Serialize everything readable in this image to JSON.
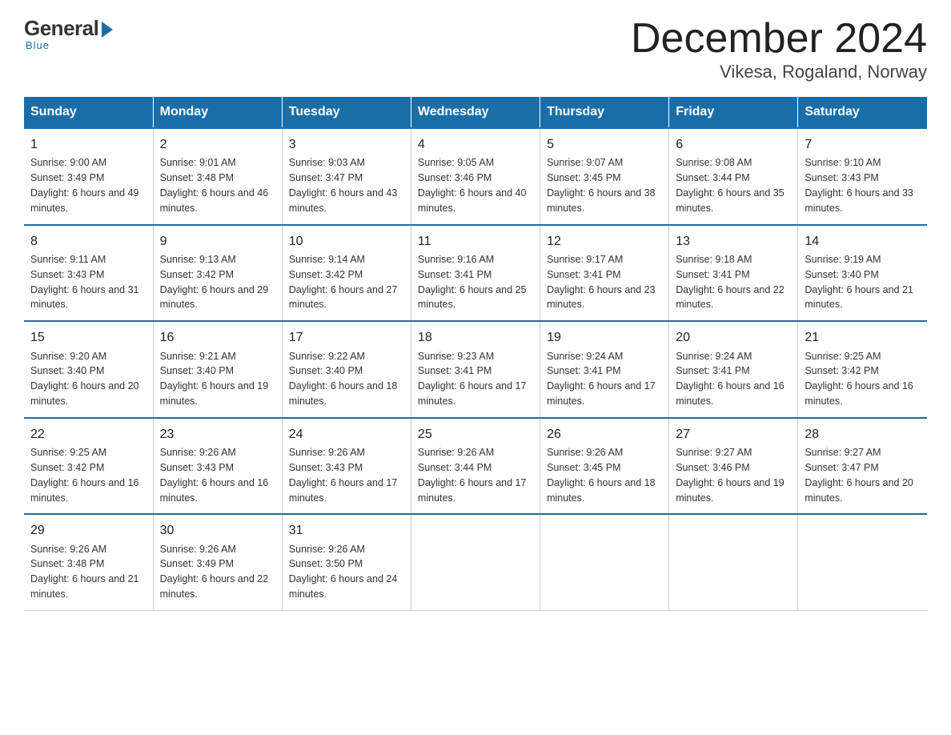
{
  "logo": {
    "general": "General",
    "blue": "Blue",
    "tagline": "Blue"
  },
  "header": {
    "month": "December 2024",
    "location": "Vikesa, Rogaland, Norway"
  },
  "days_of_week": [
    "Sunday",
    "Monday",
    "Tuesday",
    "Wednesday",
    "Thursday",
    "Friday",
    "Saturday"
  ],
  "weeks": [
    [
      {
        "day": "1",
        "sunrise": "9:00 AM",
        "sunset": "3:49 PM",
        "daylight": "6 hours and 49 minutes."
      },
      {
        "day": "2",
        "sunrise": "9:01 AM",
        "sunset": "3:48 PM",
        "daylight": "6 hours and 46 minutes."
      },
      {
        "day": "3",
        "sunrise": "9:03 AM",
        "sunset": "3:47 PM",
        "daylight": "6 hours and 43 minutes."
      },
      {
        "day": "4",
        "sunrise": "9:05 AM",
        "sunset": "3:46 PM",
        "daylight": "6 hours and 40 minutes."
      },
      {
        "day": "5",
        "sunrise": "9:07 AM",
        "sunset": "3:45 PM",
        "daylight": "6 hours and 38 minutes."
      },
      {
        "day": "6",
        "sunrise": "9:08 AM",
        "sunset": "3:44 PM",
        "daylight": "6 hours and 35 minutes."
      },
      {
        "day": "7",
        "sunrise": "9:10 AM",
        "sunset": "3:43 PM",
        "daylight": "6 hours and 33 minutes."
      }
    ],
    [
      {
        "day": "8",
        "sunrise": "9:11 AM",
        "sunset": "3:43 PM",
        "daylight": "6 hours and 31 minutes."
      },
      {
        "day": "9",
        "sunrise": "9:13 AM",
        "sunset": "3:42 PM",
        "daylight": "6 hours and 29 minutes."
      },
      {
        "day": "10",
        "sunrise": "9:14 AM",
        "sunset": "3:42 PM",
        "daylight": "6 hours and 27 minutes."
      },
      {
        "day": "11",
        "sunrise": "9:16 AM",
        "sunset": "3:41 PM",
        "daylight": "6 hours and 25 minutes."
      },
      {
        "day": "12",
        "sunrise": "9:17 AM",
        "sunset": "3:41 PM",
        "daylight": "6 hours and 23 minutes."
      },
      {
        "day": "13",
        "sunrise": "9:18 AM",
        "sunset": "3:41 PM",
        "daylight": "6 hours and 22 minutes."
      },
      {
        "day": "14",
        "sunrise": "9:19 AM",
        "sunset": "3:40 PM",
        "daylight": "6 hours and 21 minutes."
      }
    ],
    [
      {
        "day": "15",
        "sunrise": "9:20 AM",
        "sunset": "3:40 PM",
        "daylight": "6 hours and 20 minutes."
      },
      {
        "day": "16",
        "sunrise": "9:21 AM",
        "sunset": "3:40 PM",
        "daylight": "6 hours and 19 minutes."
      },
      {
        "day": "17",
        "sunrise": "9:22 AM",
        "sunset": "3:40 PM",
        "daylight": "6 hours and 18 minutes."
      },
      {
        "day": "18",
        "sunrise": "9:23 AM",
        "sunset": "3:41 PM",
        "daylight": "6 hours and 17 minutes."
      },
      {
        "day": "19",
        "sunrise": "9:24 AM",
        "sunset": "3:41 PM",
        "daylight": "6 hours and 17 minutes."
      },
      {
        "day": "20",
        "sunrise": "9:24 AM",
        "sunset": "3:41 PM",
        "daylight": "6 hours and 16 minutes."
      },
      {
        "day": "21",
        "sunrise": "9:25 AM",
        "sunset": "3:42 PM",
        "daylight": "6 hours and 16 minutes."
      }
    ],
    [
      {
        "day": "22",
        "sunrise": "9:25 AM",
        "sunset": "3:42 PM",
        "daylight": "6 hours and 16 minutes."
      },
      {
        "day": "23",
        "sunrise": "9:26 AM",
        "sunset": "3:43 PM",
        "daylight": "6 hours and 16 minutes."
      },
      {
        "day": "24",
        "sunrise": "9:26 AM",
        "sunset": "3:43 PM",
        "daylight": "6 hours and 17 minutes."
      },
      {
        "day": "25",
        "sunrise": "9:26 AM",
        "sunset": "3:44 PM",
        "daylight": "6 hours and 17 minutes."
      },
      {
        "day": "26",
        "sunrise": "9:26 AM",
        "sunset": "3:45 PM",
        "daylight": "6 hours and 18 minutes."
      },
      {
        "day": "27",
        "sunrise": "9:27 AM",
        "sunset": "3:46 PM",
        "daylight": "6 hours and 19 minutes."
      },
      {
        "day": "28",
        "sunrise": "9:27 AM",
        "sunset": "3:47 PM",
        "daylight": "6 hours and 20 minutes."
      }
    ],
    [
      {
        "day": "29",
        "sunrise": "9:26 AM",
        "sunset": "3:48 PM",
        "daylight": "6 hours and 21 minutes."
      },
      {
        "day": "30",
        "sunrise": "9:26 AM",
        "sunset": "3:49 PM",
        "daylight": "6 hours and 22 minutes."
      },
      {
        "day": "31",
        "sunrise": "9:26 AM",
        "sunset": "3:50 PM",
        "daylight": "6 hours and 24 minutes."
      },
      {
        "day": "",
        "sunrise": "",
        "sunset": "",
        "daylight": ""
      },
      {
        "day": "",
        "sunrise": "",
        "sunset": "",
        "daylight": ""
      },
      {
        "day": "",
        "sunrise": "",
        "sunset": "",
        "daylight": ""
      },
      {
        "day": "",
        "sunrise": "",
        "sunset": "",
        "daylight": ""
      }
    ]
  ]
}
